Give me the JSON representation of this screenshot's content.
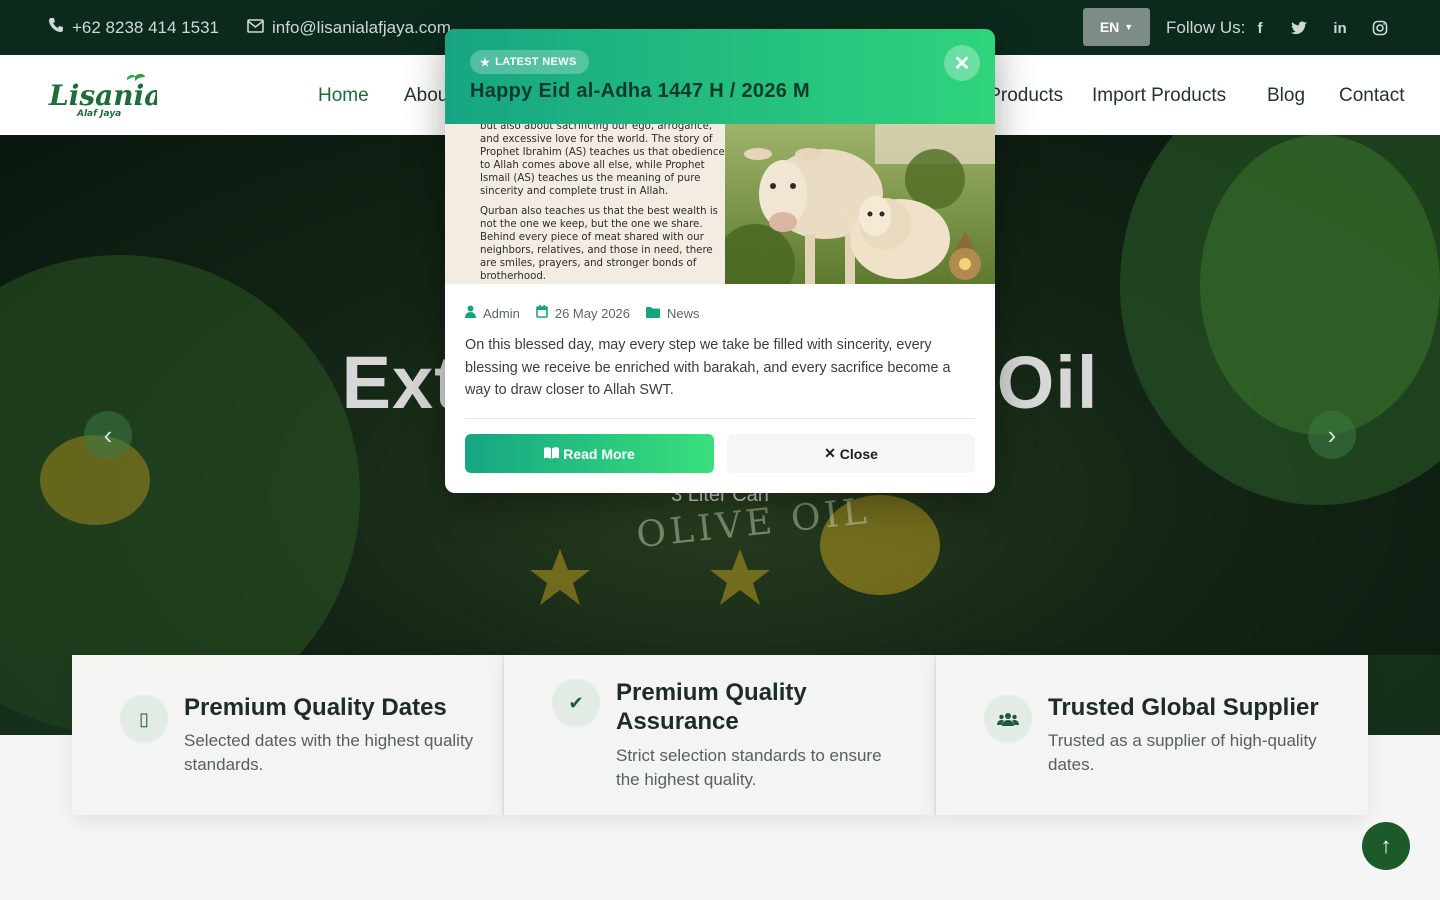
{
  "topbar": {
    "phone": "+62 8238 414 1531",
    "email": "info@lisanialafjaya.com",
    "language": "EN",
    "follow_label": "Follow Us:",
    "social_icons": [
      "facebook-icon",
      "twitter-icon",
      "linkedin-icon",
      "instagram-icon"
    ]
  },
  "nav": {
    "logo_main": "Lisania",
    "logo_sub": "Alaf Jaya",
    "items": [
      "Home",
      "About",
      "Export Products",
      "Import Products",
      "Blog",
      "Contact"
    ],
    "active": "Home"
  },
  "hero": {
    "title": "Extra Virgin Olive Oil",
    "subtitle": "3 Liter Can",
    "deco_text": "OLIVE OIL"
  },
  "features": [
    {
      "icon": "star-icon",
      "title": "Premium Quality Dates",
      "desc": "Selected dates with the highest quality standards."
    },
    {
      "icon": "check-icon",
      "title": "Premium Quality Assurance",
      "desc": "Strict selection standards to ensure the highest quality."
    },
    {
      "icon": "users-icon",
      "title": "Trusted Global Supplier",
      "desc": "Trusted as a supplier of high-quality dates."
    }
  ],
  "modal": {
    "badge": "LATEST NEWS",
    "title": "Happy Eid al-Adha 1447 H / 2026 M",
    "image_text_1": "but also about sacrificing our ego, arrogance, and excessive love for the world. The story of Prophet Ibrahim (AS) teaches us that obedience to Allah comes above all else, while Prophet Ismail (AS) teaches us the meaning of pure sincerity and complete trust in Allah.",
    "image_text_2": "Qurban also teaches us that the best wealth is not the one we keep, but the one we share. Behind every piece of meat shared with our neighbors, relatives, and those in need, there are smiles, prayers, and stronger bonds of brotherhood.",
    "author": "Admin",
    "date": "26 May 2026",
    "category": "News",
    "body": "On this blessed day, may every step we take be filled with sincerity, every blessing we receive be enriched with barakah, and every sacrifice become a way to draw closer to Allah SWT.",
    "read_more": "Read More",
    "close": "Close"
  },
  "colors": {
    "accent_start": "#17a583",
    "accent_end": "#2fd47c",
    "dark_green": "#0b2a1c"
  }
}
